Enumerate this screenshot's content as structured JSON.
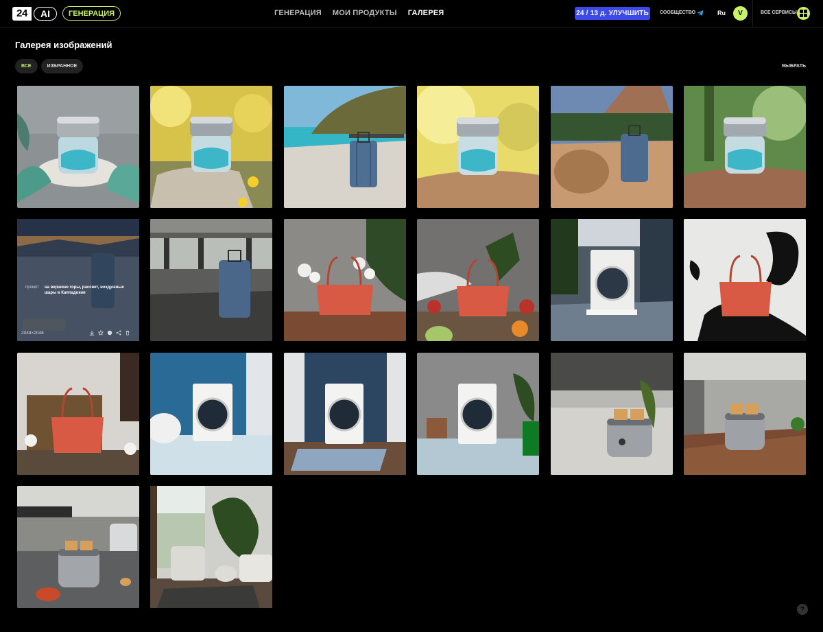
{
  "header": {
    "logo_number": "24",
    "logo_ai": "AI",
    "generation_pill": "ГЕНЕРАЦИЯ",
    "nav": [
      {
        "label": "ГЕНЕРАЦИЯ",
        "active": false
      },
      {
        "label": "МОИ ПРОДУКТЫ",
        "active": false
      },
      {
        "label": "ГАЛЕРЕЯ",
        "active": true
      }
    ],
    "upgrade_label": "24 / 13 д. УЛУЧШИТЬ",
    "community_label": "СООБЩЕСТВО",
    "language": "Ru",
    "avatar_letter": "V",
    "all_services_label": "ВСЕ СЕРВИСЫ"
  },
  "page": {
    "title": "Галерея изображений",
    "filters": [
      {
        "label": "ВСЕ",
        "active": true
      },
      {
        "label": "ИЗБРАННОЕ",
        "active": false
      }
    ],
    "select_label": "ВЫБРАТЬ"
  },
  "gallery": {
    "tiles": [
      {
        "scene": "jar-leaves"
      },
      {
        "scene": "jar-yellow-flowers"
      },
      {
        "scene": "suitcase-beach"
      },
      {
        "scene": "jar-rock-yellow"
      },
      {
        "scene": "suitcase-pyramid"
      },
      {
        "scene": "jar-green-rock"
      },
      {
        "scene": "suitcase-mountains",
        "hovered": true
      },
      {
        "scene": "suitcase-airport"
      },
      {
        "scene": "bag-flowers-table"
      },
      {
        "scene": "bag-fruits"
      },
      {
        "scene": "washer-plants"
      },
      {
        "scene": "bag-ink-splash"
      },
      {
        "scene": "bag-basket"
      },
      {
        "scene": "washer-blue-tiles"
      },
      {
        "scene": "washer-rug"
      },
      {
        "scene": "washer-grey-wall"
      },
      {
        "scene": "toaster-marble"
      },
      {
        "scene": "toaster-kitchen"
      },
      {
        "scene": "toaster-counter"
      },
      {
        "scene": "living-room"
      }
    ],
    "hover": {
      "prompt_label": "промпт",
      "prompt_text": "на вершине горы, рассвет, воздушные шары в Каппадокии",
      "size": "2048×2048"
    }
  },
  "help_label": "?",
  "colors": {
    "accent": "#c8f26a",
    "upgrade": "#3b4ae8",
    "background": "#000000"
  }
}
